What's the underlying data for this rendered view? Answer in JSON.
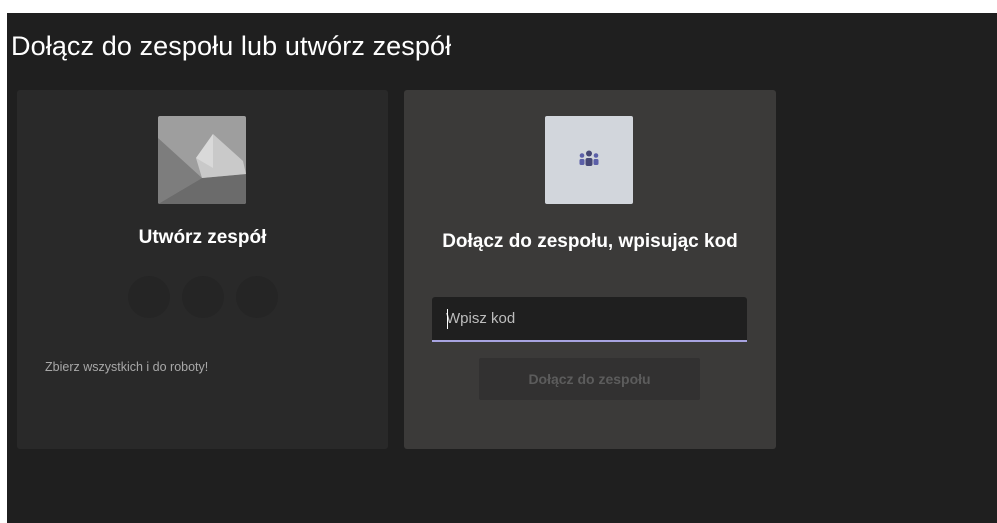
{
  "page": {
    "title": "Dołącz do zespołu lub utwórz zespół"
  },
  "create_card": {
    "title": "Utwórz zespół",
    "subtitle": "Zbierz wszystkich i do roboty!",
    "image_icon": "team-illustration-icon"
  },
  "join_card": {
    "title": "Dołącz do zespołu, wpisując kod",
    "icon": "team-people-icon",
    "input": {
      "placeholder": "Wpisz kod",
      "value": ""
    },
    "button_label": "Dołącz do zespołu"
  },
  "colors": {
    "background": "#1f1f1f",
    "create_card_bg": "#292929",
    "join_card_bg": "#3b3a39",
    "input_focus_underline": "#a7a3e0",
    "icon_tile_bg": "#d2d6dc",
    "icon_color": "#464775"
  }
}
